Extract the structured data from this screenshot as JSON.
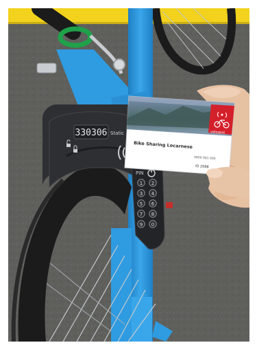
{
  "lock": {
    "display_number": "330306",
    "station_label": "Static",
    "pin_label": "PIN"
  },
  "keypad": {
    "keys": [
      "1",
      "2",
      "3",
      "4",
      "5",
      "6",
      "7",
      "8",
      "9",
      "0"
    ]
  },
  "card": {
    "title": "Bike Sharing Locarnese",
    "brand": "velospot",
    "phone": "0800 081 000",
    "id_label": "ID 2098"
  },
  "colors": {
    "bike_frame": "#2f9be0",
    "road_line": "#f2d21c",
    "asphalt": "#5d5d5a",
    "card_red": "#d4202a",
    "lock_body": "#2e2f33",
    "tire": "#1b1b1c",
    "green_band": "#1fa14a"
  },
  "icons": [
    "lock-icon",
    "unlock-icon",
    "power-icon",
    "wireless-icon",
    "bicycle-icon"
  ]
}
